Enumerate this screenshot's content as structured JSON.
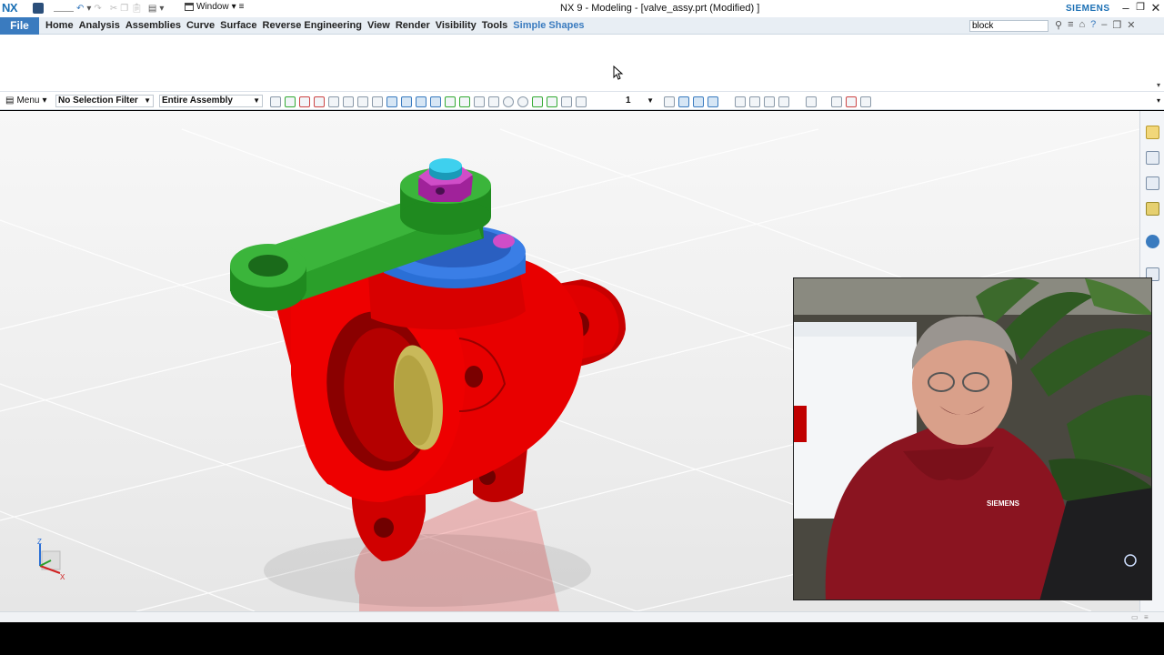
{
  "app": {
    "logo": "NX",
    "window_menu_label": "Window",
    "title": "NX 9 - Modeling - [valve_assy.prt (Modified) ]",
    "brand": "SIEMENS"
  },
  "menubar": {
    "file_label": "File",
    "tabs": [
      {
        "label": "Home"
      },
      {
        "label": "Analysis"
      },
      {
        "label": "Assemblies"
      },
      {
        "label": "Curve"
      },
      {
        "label": "Surface"
      },
      {
        "label": "Reverse Engineering"
      },
      {
        "label": "View"
      },
      {
        "label": "Render"
      },
      {
        "label": "Visibility"
      },
      {
        "label": "Tools"
      },
      {
        "label": "Simple Shapes"
      }
    ],
    "active_tab": "Simple Shapes",
    "command_search_value": "block"
  },
  "selection_bar": {
    "menu_label": "Menu",
    "selection_filter": "No Selection Filter",
    "scope": "Entire Assembly",
    "layer_value": "1"
  },
  "webcam": {
    "shirt_logo": "SIEMENS"
  },
  "colors": {
    "accent": "#3a7bbf",
    "valve_body": "#e00000",
    "handle": "#2e9a2e",
    "ring": "#2a6fd6",
    "nut": "#c23fb0"
  }
}
